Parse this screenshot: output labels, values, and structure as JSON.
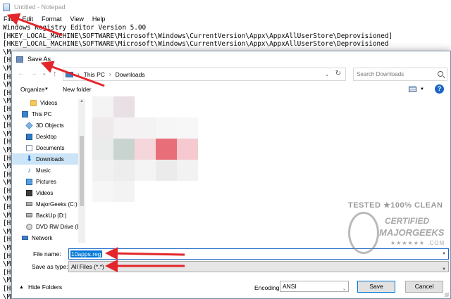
{
  "notepad": {
    "title": "Untitled - Notepad",
    "menu": [
      "File",
      "Edit",
      "Format",
      "View",
      "Help"
    ],
    "lines": [
      "Windows Registry Editor Version 5.00",
      "[HKEY_LOCAL_MACHINE\\SOFTWARE\\Microsoft\\Windows\\CurrentVersion\\Appx\\AppxAllUserStore\\Deprovisioned]",
      "[HKEY_LOCAL_MACHINE\\SOFTWARE\\Microsoft\\Windows\\CurrentVersion\\Appx\\AppxAllUserStore\\Deprovisioned",
      "\\M",
      "[H",
      "\\M",
      "[H",
      "\\M",
      "[H",
      "\\M",
      "[H",
      "\\M",
      "[H",
      "\\M",
      "[H",
      "\\M",
      "[H",
      "\\M",
      "[H",
      "\\M",
      "[H",
      "\\M",
      "[H",
      "\\M",
      "[H",
      "\\M",
      "[H",
      "\\M",
      "[H",
      "\\M",
      "[H",
      "\\M",
      "[H",
      "\\M"
    ]
  },
  "dialog": {
    "title": "Save As",
    "breadcrumb": [
      "This PC",
      "Downloads"
    ],
    "search_placeholder": "Search Downloads",
    "toolbar": {
      "organize": "Organize",
      "new_folder": "New folder"
    },
    "nav_items": [
      {
        "label": "Videos",
        "icon": "folder-icon"
      },
      {
        "label": "This PC",
        "icon": "computer-icon"
      },
      {
        "label": "3D Objects",
        "icon": "cube-icon"
      },
      {
        "label": "Desktop",
        "icon": "desktop-icon"
      },
      {
        "label": "Documents",
        "icon": "document-icon"
      },
      {
        "label": "Downloads",
        "icon": "download-arrow-icon",
        "selected": true
      },
      {
        "label": "Music",
        "icon": "music-note-icon"
      },
      {
        "label": "Pictures",
        "icon": "picture-icon"
      },
      {
        "label": "Videos",
        "icon": "film-icon"
      },
      {
        "label": "MajorGeeks (C:)",
        "icon": "drive-icon"
      },
      {
        "label": "BackUp (D:)",
        "icon": "drive-icon"
      },
      {
        "label": "DVD RW Drive (E",
        "icon": "disc-icon"
      },
      {
        "label": "Network",
        "icon": "network-icon"
      }
    ],
    "file_name_label": "File name:",
    "file_name_value": "10apps.reg",
    "save_as_type_label": "Save as type:",
    "save_as_type_value": "All Files  (*.*)",
    "hide_folders": "Hide Folders",
    "encoding_label": "Encoding:",
    "encoding_value": "ANSI",
    "save_button": "Save",
    "cancel_button": "Cancel",
    "mosaic_colors": [
      [
        "#f4f4f4",
        "#e8e0e4",
        "",
        "",
        ""
      ],
      [
        "#eeeaec",
        "#f4f2f3",
        "#f3f3f3",
        "#f6f6f6",
        "#f7f7f7"
      ],
      [
        "#e9ecea",
        "#c9d3cf",
        "#f5d6da",
        "#e86e7a",
        "#f5c9cf"
      ],
      [
        "#f1f1f1",
        "#ededed",
        "#f4f4f4",
        "#ebebeb",
        "#f2f2f2"
      ],
      [
        "#f6f6f6",
        "#f3f3f3",
        "",
        "",
        ""
      ]
    ]
  },
  "watermark": {
    "line1": "TESTED ★100% CLEAN",
    "line2": "CERTIFIED",
    "line3": "MAJORGEEKS",
    "line4": "★★★★★★ .COM"
  }
}
